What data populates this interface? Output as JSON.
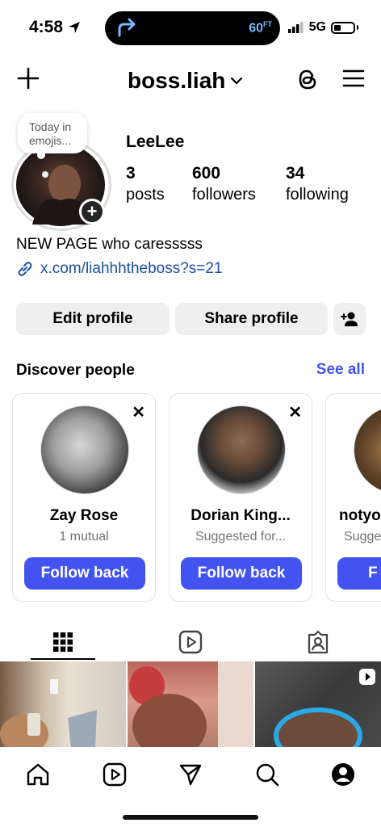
{
  "status_bar": {
    "time": "4:58",
    "temperature": "60",
    "temp_unit": "FT",
    "network": "5G"
  },
  "header": {
    "username": "boss.liah"
  },
  "profile": {
    "note_text": "Today in emojis...",
    "display_name": "LeeLee",
    "stats": [
      {
        "value": "3",
        "label": "posts"
      },
      {
        "value": "600",
        "label": "followers"
      },
      {
        "value": "34",
        "label": "following"
      }
    ],
    "bio": "NEW PAGE who caresssss",
    "link": "x.com/liahhhtheboss?s=21"
  },
  "actions": {
    "edit_profile": "Edit profile",
    "share_profile": "Share profile"
  },
  "discover": {
    "title": "Discover people",
    "see_all": "See all",
    "cards": [
      {
        "name": "Zay Rose",
        "sub": "1 mutual",
        "button": "Follow back"
      },
      {
        "name": "Dorian King...",
        "sub": "Suggested for...",
        "button": "Follow back"
      },
      {
        "name": "notyo",
        "sub": "Sugge",
        "button": "F"
      }
    ]
  },
  "colors": {
    "accent": "#4353f0",
    "link": "#1a4fa3",
    "button_bg": "#efefef"
  },
  "icons": [
    "plus-icon",
    "chevron-down-icon",
    "threads-icon",
    "menu-icon",
    "link-icon",
    "add-person-icon",
    "grid-icon",
    "reels-icon",
    "tagged-icon",
    "home-icon",
    "send-icon",
    "search-icon",
    "profile-icon"
  ]
}
